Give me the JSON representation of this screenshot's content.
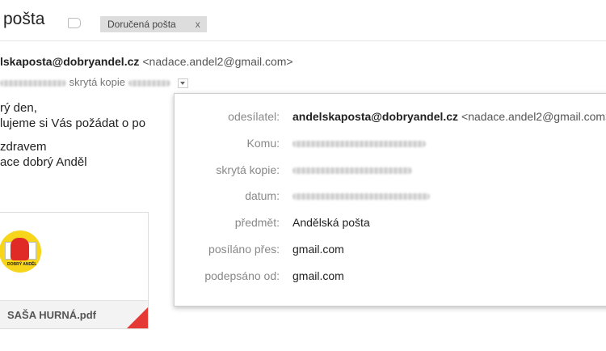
{
  "header": {
    "subject": "pošta",
    "label_chip": "Doručená pošta",
    "label_remove": "x"
  },
  "message": {
    "sender_name": "lskaposta@dobryandel.cz",
    "sender_address": "<nadace.andel2@gmail.com>",
    "bcc_label": "skrytá kopie",
    "body_lines": [
      "rý den,",
      "lujeme si Vás požádat o po",
      "zdravem",
      "ace dobrý Anděl"
    ]
  },
  "attachment": {
    "filename": "SAŠA HURNÁ.pdf",
    "logo_text": "DOBRÝ ANDĚL",
    "logo_color": "#f7d51a",
    "pdf_color": "#e53935"
  },
  "details": {
    "rows": [
      {
        "label": "odesílatel:",
        "value": "andelskaposta@dobryandel.cz",
        "extra": "<nadace.andel2@gmail.com>"
      },
      {
        "label": "Komu:",
        "value": ""
      },
      {
        "label": "skrytá kopie:",
        "value": ""
      },
      {
        "label": "datum:",
        "value": ""
      },
      {
        "label": "předmět:",
        "value": "Andělská pošta"
      },
      {
        "label": "posíláno přes:",
        "value": "gmail.com"
      },
      {
        "label": "podepsáno od:",
        "value": "gmail.com"
      }
    ]
  }
}
